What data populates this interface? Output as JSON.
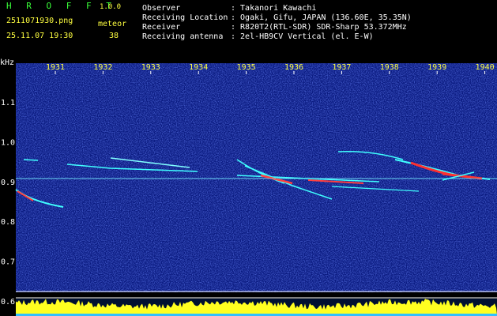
{
  "app": {
    "name": "H R O F F T",
    "version": "1.0.0",
    "filename": "2511071930.png",
    "datetime": "25.11.07 19:30",
    "count_label": "meteor",
    "count": "38"
  },
  "info": [
    {
      "label": "Observer",
      "value": ": Takanori Kawachi"
    },
    {
      "label": "Receiving Location",
      "value": ": Ogaki, Gifu, JAPAN (136.60E, 35.35N)"
    },
    {
      "label": "Receiver",
      "value": ": R820T2(RTL-SDR) SDR-Sharp 53.372MHz"
    },
    {
      "label": "Receiving antenna",
      "value": ": 2el-HB9CV Vertical (el. E-W)"
    }
  ],
  "axis": {
    "unit": "kHz",
    "time_ticks": [
      "1931",
      "1932",
      "1933",
      "1934",
      "1935",
      "1936",
      "1937",
      "1938",
      "1939",
      "1940"
    ],
    "freq_ticks": [
      "1.1",
      "1.0",
      "0.9",
      "0.8",
      "0.7",
      "0.6"
    ]
  },
  "colors": {
    "background": "#000000",
    "plot_background": "#0a1a80",
    "trace": "#40ffff",
    "hot": "#ff3030",
    "grid_line": "#a0c8ff",
    "signal_bar": "#ffff20"
  }
}
